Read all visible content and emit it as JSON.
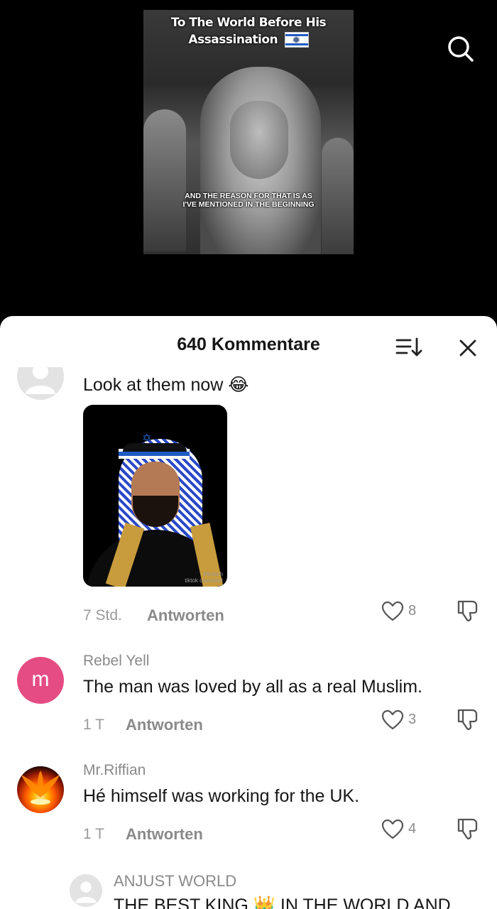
{
  "colors": {
    "accent_avatar_m": "#e54c83",
    "israel_blue": "#1f5bc4",
    "sheet_bg": "#ffffff"
  },
  "video": {
    "title_line1": "To The World Before His",
    "title_line2": "Assassination",
    "caption_line1": "AND THE REASON FOR THAT IS AS",
    "caption_line2": "I'VE MENTIONED IN THE BEGINNING"
  },
  "top_icons": {
    "search": "search-icon"
  },
  "comments_sheet": {
    "title": "640 Kommentare",
    "sort_icon": "sort-icon",
    "close_icon": "close-icon"
  },
  "comments": [
    {
      "username": "",
      "text": "Look at them now 😂",
      "image_watermark_line1": "#fintech",
      "image_watermark_line2": "tiktok comment",
      "time": "7 Std.",
      "reply_label": "Antworten",
      "likes": "8"
    },
    {
      "avatar_letter": "m",
      "username": "Rebel Yell",
      "text": "The man was loved by all as a real Muslim.",
      "time": "1 T",
      "reply_label": "Antworten",
      "likes": "3"
    },
    {
      "username": "Mr.Riffian",
      "text": "Hé himself was working for the UK.",
      "time": "1 T",
      "reply_label": "Antworten",
      "likes": "4"
    },
    {
      "username": "ANJUST WORLD",
      "text": "THE BEST KING 👑 IN THE WORLD AND"
    }
  ]
}
